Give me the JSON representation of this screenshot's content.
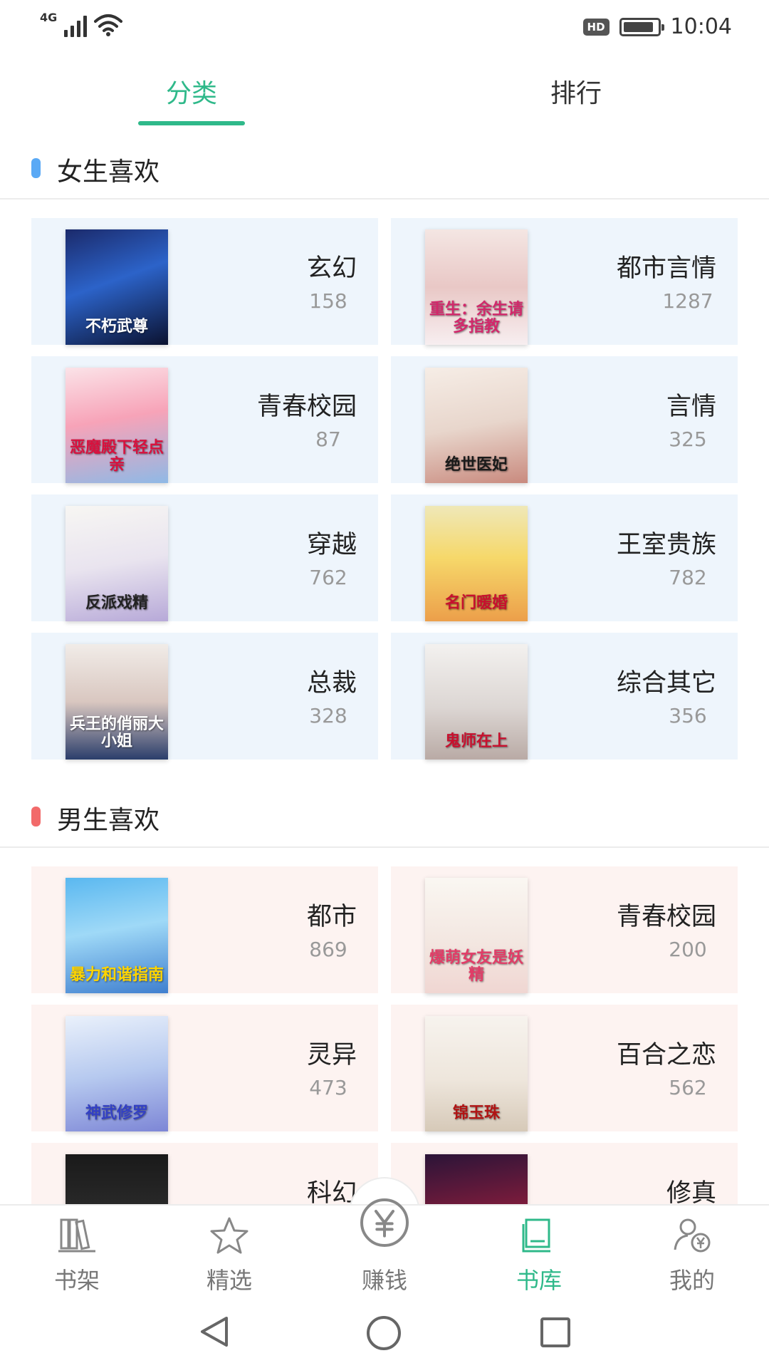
{
  "status_bar": {
    "network": "4G",
    "hd": "HD",
    "time": "10:04",
    "battery_level": 0.9
  },
  "tabs": [
    {
      "label": "分类",
      "active": true
    },
    {
      "label": "排行",
      "active": false
    }
  ],
  "girls_section": {
    "title": "女生喜欢",
    "marker_color": "#5aa9f5",
    "categories": [
      {
        "name": "玄幻",
        "count": "158",
        "cover_text": "不朽武尊",
        "cover_bg": "linear-gradient(160deg,#1b2a6b 0%,#2c63c9 45%,#0b1230 100%)",
        "cover_fg": "#ffffff"
      },
      {
        "name": "都市言情",
        "count": "1287",
        "cover_text": "重生：余生请多指教",
        "cover_bg": "linear-gradient(180deg,#f4e6e3 0%,#e9c8c6 50%,#f7eef0 100%)",
        "cover_fg": "#d2286b"
      },
      {
        "name": "青春校园",
        "count": "87",
        "cover_text": "恶魔殿下轻点亲",
        "cover_bg": "linear-gradient(170deg,#fbe3e8 0%,#f7a3b8 45%,#8fb9e6 100%)",
        "cover_fg": "#d8113e"
      },
      {
        "name": "言情",
        "count": "325",
        "cover_text": "绝世医妃",
        "cover_bg": "linear-gradient(170deg,#f6ede6 0%,#e8d6cc 50%,#c98a7e 100%)",
        "cover_fg": "#1a1a1a"
      },
      {
        "name": "穿越",
        "count": "762",
        "cover_text": "反派戏精",
        "cover_bg": "linear-gradient(170deg,#f7f6f3 0%,#e9e4ef 50%,#b7a9d8 100%)",
        "cover_fg": "#222222"
      },
      {
        "name": "王室贵族",
        "count": "782",
        "cover_text": "名门暖婚",
        "cover_bg": "linear-gradient(180deg,#efe8b8 0%,#f6d86a 45%,#ec9f4a 100%)",
        "cover_fg": "#c8102e"
      },
      {
        "name": "总裁",
        "count": "328",
        "cover_text": "兵王的俏丽大小姐",
        "cover_bg": "linear-gradient(180deg,#f1ece8 0%,#d9c7c0 50%,#2b3e6b 100%)",
        "cover_fg": "#ffffff"
      },
      {
        "name": "综合其它",
        "count": "356",
        "cover_text": "鬼师在上",
        "cover_bg": "linear-gradient(180deg,#f3f1ef 0%,#dcd6d3 55%,#b9aaa5 100%)",
        "cover_fg": "#c8102e"
      }
    ]
  },
  "boys_section": {
    "title": "男生喜欢",
    "marker_color": "#f26a6a",
    "categories": [
      {
        "name": "都市",
        "count": "869",
        "cover_text": "暴力和谐指南",
        "cover_bg": "linear-gradient(170deg,#5ab8f0 0%,#9fd9f7 45%,#3f7fcf 100%)",
        "cover_fg": "#ffd400"
      },
      {
        "name": "青春校园",
        "count": "200",
        "cover_text": "爆萌女友是妖精",
        "cover_bg": "linear-gradient(180deg,#faf7f2 0%,#f3e7e1 55%,#f0d6d2 100%)",
        "cover_fg": "#e23c67"
      },
      {
        "name": "灵异",
        "count": "473",
        "cover_text": "神武修罗",
        "cover_bg": "linear-gradient(170deg,#eaf1fb 0%,#b6c9ef 50%,#7d86d6 100%)",
        "cover_fg": "#3340c4"
      },
      {
        "name": "百合之恋",
        "count": "562",
        "cover_text": "锦玉珠",
        "cover_bg": "linear-gradient(180deg,#f7f3ee 0%,#eee6dc 55%,#d6c9b8 100%)",
        "cover_fg": "#b11414"
      },
      {
        "name": "科幻",
        "count": "",
        "cover_text": "",
        "cover_bg": "linear-gradient(180deg,#1a1a1a 0%,#3a3a3a 100%)",
        "cover_fg": "#ffffff"
      },
      {
        "name": "修真",
        "count": "",
        "cover_text": "",
        "cover_bg": "linear-gradient(170deg,#2b1438 0%,#8a1d3c 60%,#2a2a4a 100%)",
        "cover_fg": "#ffffff"
      }
    ]
  },
  "bottom_nav": [
    {
      "label": "书架",
      "icon": "bookshelf-icon",
      "active": false
    },
    {
      "label": "精选",
      "icon": "star-icon",
      "active": false
    },
    {
      "label": "赚钱",
      "icon": "yuan-coin-icon",
      "active": false
    },
    {
      "label": "书库",
      "icon": "book-library-icon",
      "active": true
    },
    {
      "label": "我的",
      "icon": "user-yuan-icon",
      "active": false
    }
  ],
  "colors": {
    "accent": "#2fb98a",
    "girls_card_bg": "#eef5fc",
    "boys_card_bg": "#fdf3f1"
  }
}
